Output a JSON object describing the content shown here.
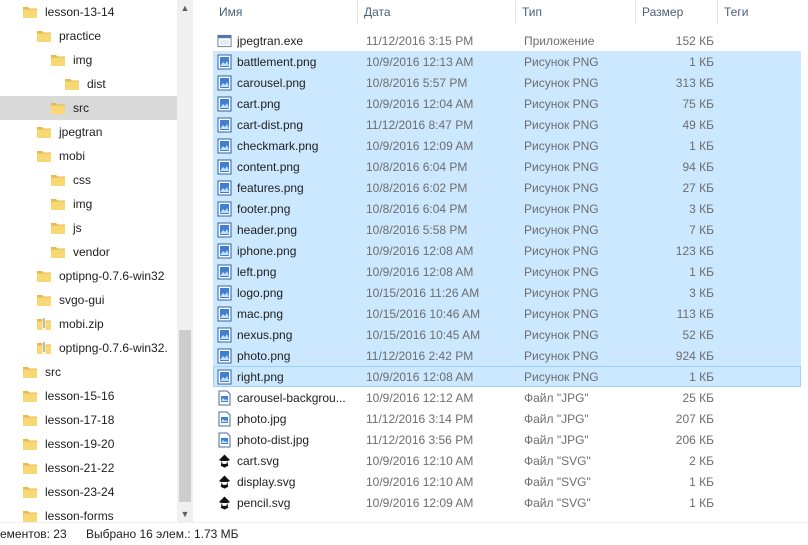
{
  "nav": {
    "items": [
      {
        "label": "lesson-13-14",
        "icon": "folder-icon"
      },
      {
        "label": "practice",
        "icon": "folder-icon"
      },
      {
        "label": "img",
        "icon": "folder-icon"
      },
      {
        "label": "dist",
        "icon": "folder-icon"
      },
      {
        "label": "src",
        "icon": "folder-icon",
        "selected": true
      },
      {
        "label": "jpegtran",
        "icon": "folder-icon"
      },
      {
        "label": "mobi",
        "icon": "folder-icon"
      },
      {
        "label": "css",
        "icon": "folder-icon"
      },
      {
        "label": "img",
        "icon": "folder-icon"
      },
      {
        "label": "js",
        "icon": "folder-icon"
      },
      {
        "label": "vendor",
        "icon": "folder-icon"
      },
      {
        "label": "optipng-0.7.6-win32",
        "icon": "folder-icon"
      },
      {
        "label": "svgo-gui",
        "icon": "folder-icon"
      },
      {
        "label": "mobi.zip",
        "icon": "zip-folder-icon"
      },
      {
        "label": "optipng-0.7.6-win32.",
        "icon": "zip-folder-icon"
      },
      {
        "label": "src",
        "icon": "folder-icon"
      },
      {
        "label": "lesson-15-16",
        "icon": "folder-icon"
      },
      {
        "label": "lesson-17-18",
        "icon": "folder-icon"
      },
      {
        "label": "lesson-19-20",
        "icon": "folder-icon"
      },
      {
        "label": "lesson-21-22",
        "icon": "folder-icon"
      },
      {
        "label": "lesson-23-24",
        "icon": "folder-icon"
      },
      {
        "label": "lesson-forms",
        "icon": "folder-icon"
      }
    ]
  },
  "columns": {
    "name": "Имя",
    "date": "Дата",
    "type": "Тип",
    "size": "Размер",
    "tags": "Теги"
  },
  "files": [
    {
      "name": "jpegtran.exe",
      "date": "11/12/2016 3:15 PM",
      "type": "Приложение",
      "size": "152 КБ",
      "icon": "exe-icon",
      "selected": false
    },
    {
      "name": "battlement.png",
      "date": "10/9/2016 12:13 AM",
      "type": "Рисунок PNG",
      "size": "1 КБ",
      "icon": "png-icon",
      "selected": true
    },
    {
      "name": "carousel.png",
      "date": "10/8/2016 5:57 PM",
      "type": "Рисунок PNG",
      "size": "313 КБ",
      "icon": "png-icon",
      "selected": true
    },
    {
      "name": "cart.png",
      "date": "10/9/2016 12:04 AM",
      "type": "Рисунок PNG",
      "size": "75 КБ",
      "icon": "png-icon",
      "selected": true
    },
    {
      "name": "cart-dist.png",
      "date": "11/12/2016 8:47 PM",
      "type": "Рисунок PNG",
      "size": "49 КБ",
      "icon": "png-icon",
      "selected": true
    },
    {
      "name": "checkmark.png",
      "date": "10/9/2016 12:09 AM",
      "type": "Рисунок PNG",
      "size": "1 КБ",
      "icon": "png-icon",
      "selected": true
    },
    {
      "name": "content.png",
      "date": "10/8/2016 6:04 PM",
      "type": "Рисунок PNG",
      "size": "94 КБ",
      "icon": "png-icon",
      "selected": true
    },
    {
      "name": "features.png",
      "date": "10/8/2016 6:02 PM",
      "type": "Рисунок PNG",
      "size": "27 КБ",
      "icon": "png-icon",
      "selected": true
    },
    {
      "name": "footer.png",
      "date": "10/8/2016 6:04 PM",
      "type": "Рисунок PNG",
      "size": "3 КБ",
      "icon": "png-icon",
      "selected": true
    },
    {
      "name": "header.png",
      "date": "10/8/2016 5:58 PM",
      "type": "Рисунок PNG",
      "size": "7 КБ",
      "icon": "png-icon",
      "selected": true
    },
    {
      "name": "iphone.png",
      "date": "10/9/2016 12:08 AM",
      "type": "Рисунок PNG",
      "size": "123 КБ",
      "icon": "png-icon",
      "selected": true
    },
    {
      "name": "left.png",
      "date": "10/9/2016 12:08 AM",
      "type": "Рисунок PNG",
      "size": "1 КБ",
      "icon": "png-icon",
      "selected": true
    },
    {
      "name": "logo.png",
      "date": "10/15/2016 11:26 AM",
      "type": "Рисунок PNG",
      "size": "3 КБ",
      "icon": "png-icon",
      "selected": true
    },
    {
      "name": "mac.png",
      "date": "10/15/2016 10:46 AM",
      "type": "Рисунок PNG",
      "size": "113 КБ",
      "icon": "png-icon",
      "selected": true
    },
    {
      "name": "nexus.png",
      "date": "10/15/2016 10:45 AM",
      "type": "Рисунок PNG",
      "size": "52 КБ",
      "icon": "png-icon",
      "selected": true
    },
    {
      "name": "photo.png",
      "date": "11/12/2016 2:42 PM",
      "type": "Рисунок PNG",
      "size": "924 КБ",
      "icon": "png-icon",
      "selected": true
    },
    {
      "name": "right.png",
      "date": "10/9/2016 12:08 AM",
      "type": "Рисунок PNG",
      "size": "1 КБ",
      "icon": "png-icon",
      "selected": true,
      "focused": true
    },
    {
      "name": "carousel-backgrou...",
      "date": "10/9/2016 12:12 AM",
      "type": "Файл \"JPG\"",
      "size": "25 КБ",
      "icon": "jpg-icon",
      "selected": false
    },
    {
      "name": "photo.jpg",
      "date": "11/12/2016 3:14 PM",
      "type": "Файл \"JPG\"",
      "size": "207 КБ",
      "icon": "jpg-icon",
      "selected": false
    },
    {
      "name": "photo-dist.jpg",
      "date": "11/12/2016 3:56 PM",
      "type": "Файл \"JPG\"",
      "size": "206 КБ",
      "icon": "jpg-icon",
      "selected": false
    },
    {
      "name": "cart.svg",
      "date": "10/9/2016 12:10 AM",
      "type": "Файл \"SVG\"",
      "size": "2 КБ",
      "icon": "svg-inkscape-icon",
      "selected": false
    },
    {
      "name": "display.svg",
      "date": "10/9/2016 12:10 AM",
      "type": "Файл \"SVG\"",
      "size": "1 КБ",
      "icon": "svg-inkscape-icon",
      "selected": false
    },
    {
      "name": "pencil.svg",
      "date": "10/9/2016 12:09 AM",
      "type": "Файл \"SVG\"",
      "size": "1 КБ",
      "icon": "svg-inkscape-icon",
      "selected": false
    }
  ],
  "status": {
    "count": "ементов: 23",
    "selection": "Выбрано 16 элем.: 1.73 МБ"
  },
  "colors": {
    "selection": "#cce8ff",
    "focus_border": "#99d1ff",
    "nav_selected": "#d9d9d9",
    "folder": "#f8d775",
    "header_text": "#4c607a"
  }
}
